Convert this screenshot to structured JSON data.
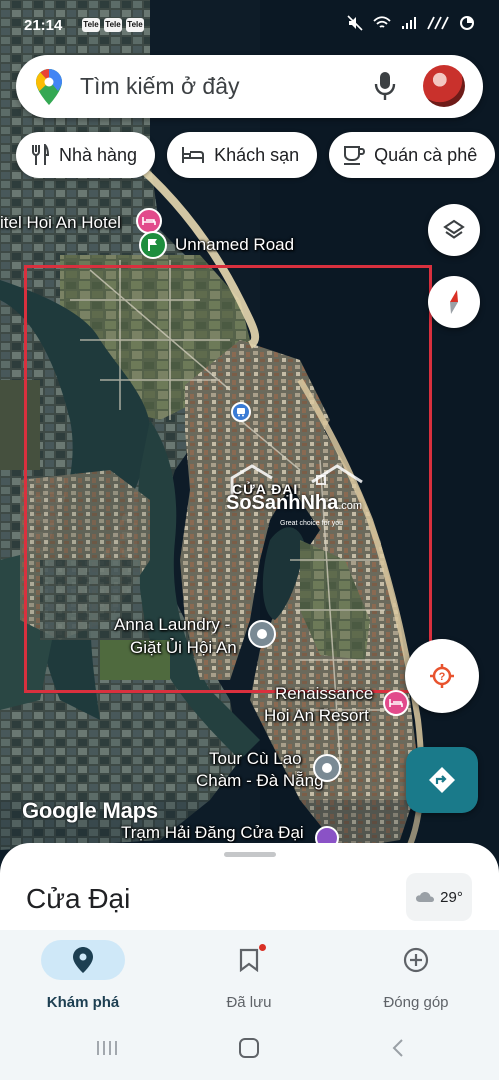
{
  "status_bar": {
    "time": "21:14",
    "mini_icons": [
      "Tele",
      "Tele",
      "Tele"
    ],
    "right_icons": [
      "mute-icon",
      "wifi-icon",
      "signal-icon",
      "battery-icon"
    ]
  },
  "search": {
    "placeholder": "Tìm kiếm ở đây"
  },
  "chips": [
    {
      "label": "Nhà hàng",
      "icon": "fork-knife-icon"
    },
    {
      "label": "Khách sạn",
      "icon": "bed-icon"
    },
    {
      "label": "Quán cà phê",
      "icon": "coffee-icon"
    }
  ],
  "map": {
    "labels": {
      "hotel_hoi_an": "itel Hoi An Hotel",
      "unnamed_road": "Unnamed Road",
      "anna_line1": "Anna Laundry -",
      "anna_line2": "Giặt Ủi Hội An",
      "renaissance_line1": "Renaissance",
      "renaissance_line2": "Hoi An Resort",
      "tour_line1": "Tour Cù Lao",
      "tour_line2": "Chàm - Đà Nẵng",
      "tram": "Trạm Hải Đăng Cửa Đại",
      "area": "CỬA ĐẠI"
    },
    "watermark": {
      "brand": "SoSanhNha",
      "domain": ".com",
      "tagline": "Great choice for you"
    },
    "google_logo": "Google Maps",
    "colors": {
      "water": "#0d1c28",
      "land": "#4a5340",
      "highlight_box": "#d9303e",
      "hotel_pin": "#e24a8b",
      "road_pin": "#1e8e3e",
      "directions": "#1a7a8a",
      "location_icon": "#e8532e"
    }
  },
  "sheet": {
    "title": "Cửa Đại",
    "weather": "29°"
  },
  "bottom_nav": [
    {
      "label": "Khám phá",
      "icon": "location-pin-icon",
      "active": true
    },
    {
      "label": "Đã lưu",
      "icon": "bookmark-icon",
      "active": false
    },
    {
      "label": "Đóng góp",
      "icon": "add-circle-icon",
      "active": false
    }
  ]
}
